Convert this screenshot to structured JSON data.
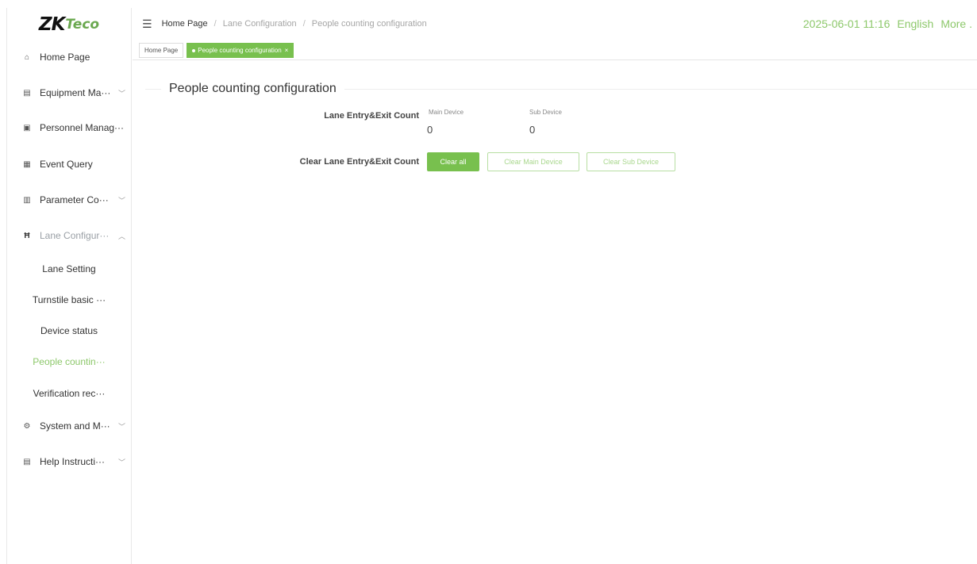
{
  "logo": {
    "main": "ZK",
    "accent": "Teco"
  },
  "sidebar": {
    "items": [
      {
        "label": "Home Page",
        "icon": "home-icon",
        "glyph": "⌂"
      },
      {
        "label": "Equipment Ma···",
        "icon": "equipment-icon",
        "glyph": "▤",
        "chevron": "﹀"
      },
      {
        "label": "Personnel Manag···",
        "icon": "personnel-icon",
        "glyph": "▣"
      },
      {
        "label": "Event Query",
        "icon": "event-icon",
        "glyph": "▦"
      },
      {
        "label": "Parameter Co···",
        "icon": "parameter-icon",
        "glyph": "▥",
        "chevron": "﹀"
      },
      {
        "label": "Lane Configur···",
        "icon": "lane-icon",
        "glyph": "Ħ",
        "chevron": "︿"
      },
      {
        "label": "System and M···",
        "icon": "system-icon",
        "glyph": "⚙",
        "chevron": "﹀"
      },
      {
        "label": "Help Instructi···",
        "icon": "help-icon",
        "glyph": "▤",
        "chevron": "﹀"
      }
    ],
    "subitems": [
      {
        "label": "Lane Setting"
      },
      {
        "label": "Turnstile basic ···"
      },
      {
        "label": "Device status"
      },
      {
        "label": "People countin···"
      },
      {
        "label": "Verification rec···"
      }
    ]
  },
  "topbar": {
    "menu_glyph": "☰",
    "breadcrumb": [
      "Home Page",
      "Lane Configuration",
      "People counting configuration"
    ],
    "separator": "/",
    "datetime": "2025-06-01 11:16",
    "language": "English",
    "more": "More ."
  },
  "tabs": [
    {
      "label": "Home Page"
    },
    {
      "label": "People counting configuration",
      "close": "×"
    }
  ],
  "content": {
    "title": "People counting configuration",
    "count_label": "Lane Entry&Exit Count",
    "main_device_caption": "Main Device",
    "sub_device_caption": "Sub Device",
    "main_device_value": "0",
    "sub_device_value": "0",
    "clear_label": "Clear Lane Entry&Exit Count",
    "buttons": {
      "clear_all": "Clear all",
      "clear_main": "Clear Main Device",
      "clear_sub": "Clear Sub Device"
    }
  },
  "colors": {
    "accent": "#78c04e",
    "accent_text": "#8dc86b"
  }
}
